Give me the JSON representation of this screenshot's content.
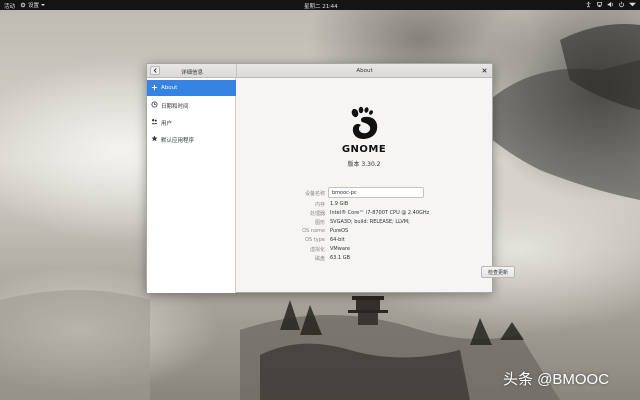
{
  "topbar": {
    "activities": "活动",
    "app_menu": "设置",
    "clock": "星期二 21∶44"
  },
  "window": {
    "sidebar_title": "详细信息",
    "main_title": "About"
  },
  "sidebar": {
    "items": [
      {
        "label": "About",
        "icon": "plus-icon",
        "active": true
      },
      {
        "label": "日期和时间",
        "icon": "clock-icon",
        "active": false
      },
      {
        "label": "用户",
        "icon": "users-icon",
        "active": false
      },
      {
        "label": "默认应用程序",
        "icon": "star-icon",
        "active": false
      }
    ]
  },
  "about": {
    "logo_text": "GNOME",
    "version": "版本 3.30.2",
    "device_name_label": "设备名称",
    "device_name_value": "bmooc-pc",
    "rows": [
      {
        "label": "内存",
        "value": "1.9 GiB"
      },
      {
        "label": "处理器",
        "value": "Intel® Core™ i7-8700T CPU @ 2.40GHz"
      },
      {
        "label": "图形",
        "value": "SVGA3D; build: RELEASE; LLVM;"
      },
      {
        "label": "OS name",
        "value": "PureOS"
      },
      {
        "label": "OS type",
        "value": "64-bit"
      },
      {
        "label": "虚拟化",
        "value": "VMware"
      },
      {
        "label": "磁盘",
        "value": "63.1 GB"
      }
    ],
    "check_updates": "检查更新"
  },
  "watermark": "头条 @BMOOC",
  "colors": {
    "accent": "#3584e4",
    "topbar": "#141414"
  }
}
